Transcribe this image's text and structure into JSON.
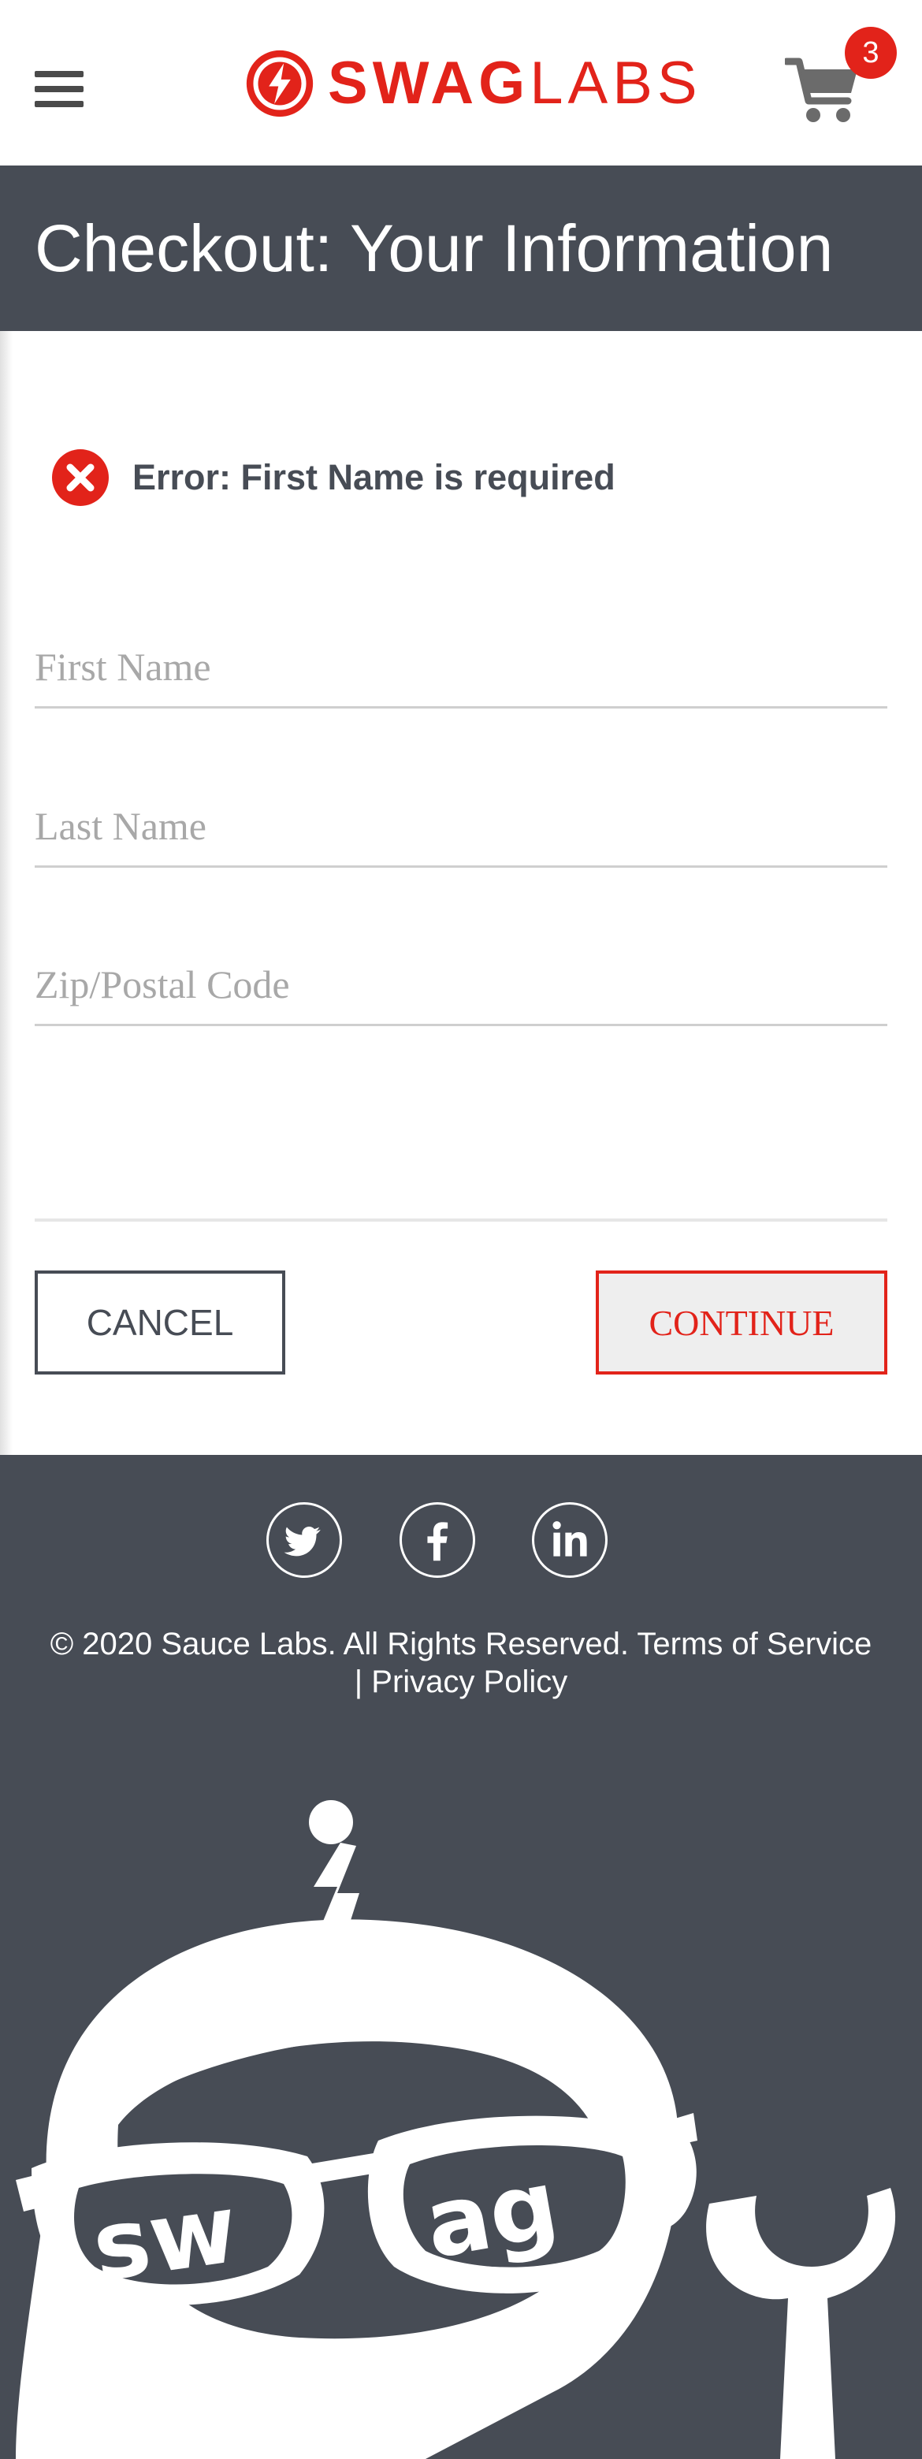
{
  "header": {
    "brand_bold": "SWAG",
    "brand_light": "LABS",
    "cart_count": "3",
    "icons": [
      "hamburger-menu-icon",
      "swag-labs-logo-icon",
      "shopping-cart-icon"
    ]
  },
  "page": {
    "title": "Checkout: Your Information"
  },
  "error": {
    "message": "Error: First Name is required",
    "icon": "error-x-icon"
  },
  "form": {
    "first_name_placeholder": "First Name",
    "last_name_placeholder": "Last Name",
    "postal_code_placeholder": "Zip/Postal Code",
    "first_name_value": "",
    "last_name_value": "",
    "postal_code_value": ""
  },
  "actions": {
    "cancel_label": "CANCEL",
    "continue_label": "CONTINUE"
  },
  "footer": {
    "social_icons": [
      "twitter-icon",
      "facebook-icon",
      "linkedin-icon"
    ],
    "copyright_line1": "© 2020 Sauce Labs. All Rights Reserved. Terms of Service",
    "copyright_line2": "| Privacy Policy",
    "robot_lettering": "swag"
  },
  "colors": {
    "brand_red": "#e2231a",
    "dark_gray": "#474c55"
  }
}
